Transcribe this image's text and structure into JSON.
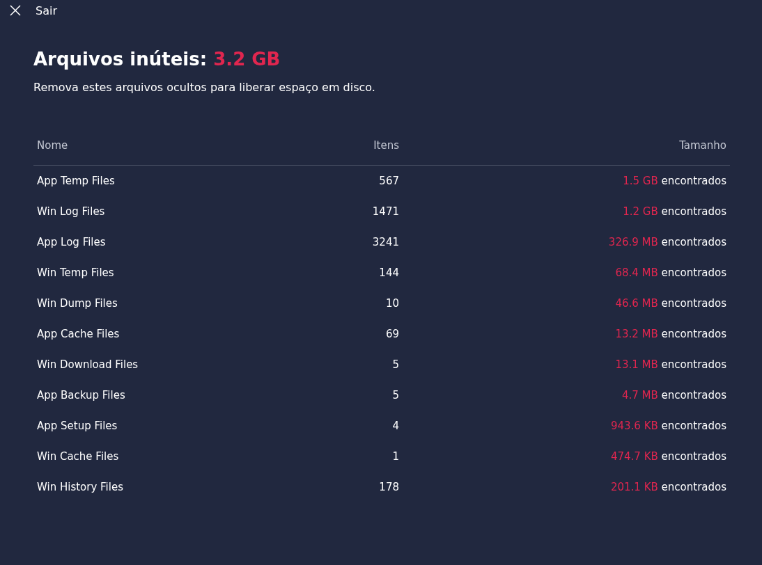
{
  "topbar": {
    "exit_label": "Sair"
  },
  "heading": {
    "title": "Arquivos inúteis:",
    "total": "3.2 GB"
  },
  "subtitle": "Remova estes arquivos ocultos para liberar espaço em disco.",
  "table": {
    "columns": [
      "Nome",
      "Itens",
      "Tamanho"
    ],
    "rows": [
      {
        "name": "App Temp Files",
        "items": "567",
        "size": "1.5 GB",
        "suffix": "encontrados"
      },
      {
        "name": "Win Log Files",
        "items": "1471",
        "size": "1.2 GB",
        "suffix": "encontrados"
      },
      {
        "name": "App Log Files",
        "items": "3241",
        "size": "326.9 MB",
        "suffix": "encontrados"
      },
      {
        "name": "Win Temp Files",
        "items": "144",
        "size": "68.4 MB",
        "suffix": "encontrados"
      },
      {
        "name": "Win Dump Files",
        "items": "10",
        "size": "46.6 MB",
        "suffix": "encontrados"
      },
      {
        "name": "App Cache Files",
        "items": "69",
        "size": "13.2 MB",
        "suffix": "encontrados"
      },
      {
        "name": "Win Download Files",
        "items": "5",
        "size": "13.1 MB",
        "suffix": "encontrados"
      },
      {
        "name": "App Backup Files",
        "items": "5",
        "size": "4.7 MB",
        "suffix": "encontrados"
      },
      {
        "name": "App Setup Files",
        "items": "4",
        "size": "943.6 KB",
        "suffix": "encontrados"
      },
      {
        "name": "Win Cache Files",
        "items": "1",
        "size": "474.7 KB",
        "suffix": "encontrados"
      },
      {
        "name": "Win History Files",
        "items": "178",
        "size": "201.1 KB",
        "suffix": "encontrados"
      }
    ]
  }
}
